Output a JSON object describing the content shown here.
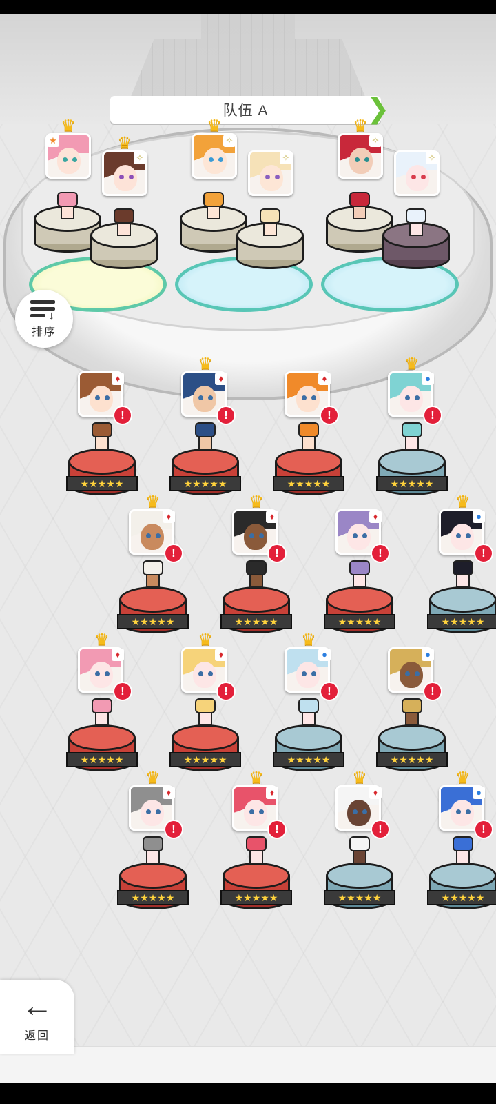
{
  "team": {
    "name": "队伍 A"
  },
  "sort_button": {
    "label": "排序",
    "icon": "sort-list-icon"
  },
  "back_button": {
    "label": "返回",
    "icon": "arrow-left-icon"
  },
  "colors": {
    "accent_green": "#6bc13a",
    "alert_red": "#e3203a",
    "crown_gold": "#f6bb1c",
    "pedestal_red": "#e46054",
    "pedestal_blue": "#a8c9d3"
  },
  "team_slots": [
    {
      "hair": "#f29ab3",
      "skin": "#fde3d8",
      "eye": "#3aa6a0",
      "crown": true,
      "suit": "star-icon",
      "pedestal": "stone"
    },
    {
      "hair": "#6b3b2c",
      "skin": "#fde3d8",
      "eye": "#8d4fb8",
      "crown": true,
      "suit": "spark-icon",
      "pedestal": "stone"
    },
    {
      "hair": "#f2a23a",
      "skin": "#fde6d6",
      "eye": "#3a9bd6",
      "crown": true,
      "suit": "spark-icon",
      "pedestal": "stone"
    },
    {
      "hair": "#f6e2b8",
      "skin": "#fde6d6",
      "eye": "#8a5fc0",
      "crown": false,
      "suit": "spark-icon",
      "pedestal": "stone"
    },
    {
      "hair": "#c8283a",
      "skin": "#f2cdb8",
      "eye": "#2a8f8f",
      "crown": true,
      "suit": "spark-icon",
      "pedestal": "stone"
    },
    {
      "hair": "#e9f2fb",
      "skin": "#fde6e6",
      "eye": "#d93c4c",
      "crown": false,
      "suit": "spark-icon",
      "pedestal": "dark"
    }
  ],
  "roster": [
    {
      "hair": "#9b5b34",
      "skin": "#fde1cf",
      "crown": false,
      "suit": "heart",
      "pedestal": "red",
      "stars": "★★★★★"
    },
    {
      "hair": "#2c4f86",
      "skin": "#f0c7a6",
      "crown": true,
      "suit": "heart",
      "pedestal": "red",
      "stars": "★★★★★"
    },
    {
      "hair": "#f08a2a",
      "skin": "#fde1cf",
      "crown": false,
      "suit": "heart",
      "pedestal": "red",
      "stars": "★★★★★"
    },
    {
      "hair": "#7fd3d3",
      "skin": "#fde6e6",
      "crown": true,
      "suit": "dot",
      "pedestal": "blue",
      "stars": "★★★★★"
    },
    {
      "hair": "#f3f0ea",
      "skin": "#c98a5e",
      "crown": true,
      "suit": "heart",
      "pedestal": "red",
      "stars": "★★★★★"
    },
    {
      "hair": "#2a2a2a",
      "skin": "#8a5a3a",
      "crown": true,
      "suit": "heart",
      "pedestal": "red",
      "stars": "★★★★★"
    },
    {
      "hair": "#9a86c6",
      "skin": "#fde6e6",
      "crown": false,
      "suit": "heart",
      "pedestal": "red",
      "stars": "★★★★★"
    },
    {
      "hair": "#1e1e2a",
      "skin": "#fde6e6",
      "crown": true,
      "suit": "dot",
      "pedestal": "blue",
      "stars": "★★★★★"
    },
    {
      "hair": "#f29ab3",
      "skin": "#fde6e6",
      "crown": true,
      "suit": "heart",
      "pedestal": "red",
      "stars": "★★★★★"
    },
    {
      "hair": "#f6d37a",
      "skin": "#fde6e6",
      "crown": true,
      "suit": "heart",
      "pedestal": "red",
      "stars": "★★★★★"
    },
    {
      "hair": "#bfe0ef",
      "skin": "#fde6e6",
      "crown": true,
      "suit": "dot",
      "pedestal": "blue",
      "stars": "★★★★★"
    },
    {
      "hair": "#d6b05a",
      "skin": "#8a5a3a",
      "crown": false,
      "suit": "dot",
      "pedestal": "blue",
      "stars": "★★★★★"
    },
    {
      "hair": "#8f8f8f",
      "skin": "#fde6e6",
      "crown": true,
      "suit": "heart",
      "pedestal": "red",
      "stars": "★★★★★"
    },
    {
      "hair": "#e8536a",
      "skin": "#fde6e6",
      "crown": true,
      "suit": "heart",
      "pedestal": "red",
      "stars": "★★★★★"
    },
    {
      "hair": "#f5f5f5",
      "skin": "#6a4434",
      "crown": true,
      "suit": "heart",
      "pedestal": "blue",
      "stars": "★★★★★"
    },
    {
      "hair": "#3a6fd6",
      "skin": "#fde6e6",
      "crown": true,
      "suit": "dot",
      "pedestal": "blue",
      "stars": "★★★★★"
    }
  ]
}
